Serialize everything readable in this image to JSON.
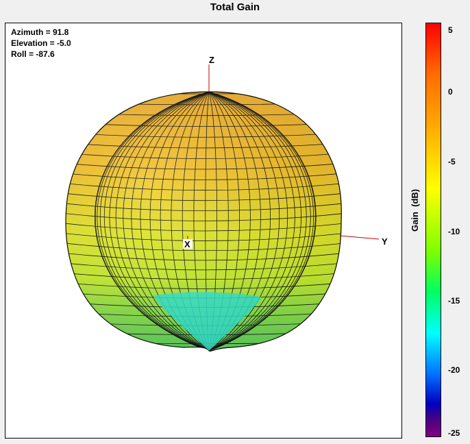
{
  "title": "Total Gain",
  "view": {
    "azimuth_text": "Azimuth = 91.8",
    "elevation_text": "Elevation = -5.0",
    "roll_text": "Roll = -87.6"
  },
  "axes": {
    "x": "X",
    "y": "Y",
    "z": "Z"
  },
  "colorbar": {
    "label": "Gain  (dB)",
    "ticks": [
      "5",
      "0",
      "-5",
      "-10",
      "-15",
      "-20",
      "-25"
    ],
    "min": -25,
    "max": 5
  },
  "colors": {
    "upper_surface": "#f5b82a",
    "mid_surface": "#e0ee28",
    "lower_surface": "#7ee04a",
    "null_surface": "#2ee8d8",
    "axis_line": "#cc0000"
  }
}
